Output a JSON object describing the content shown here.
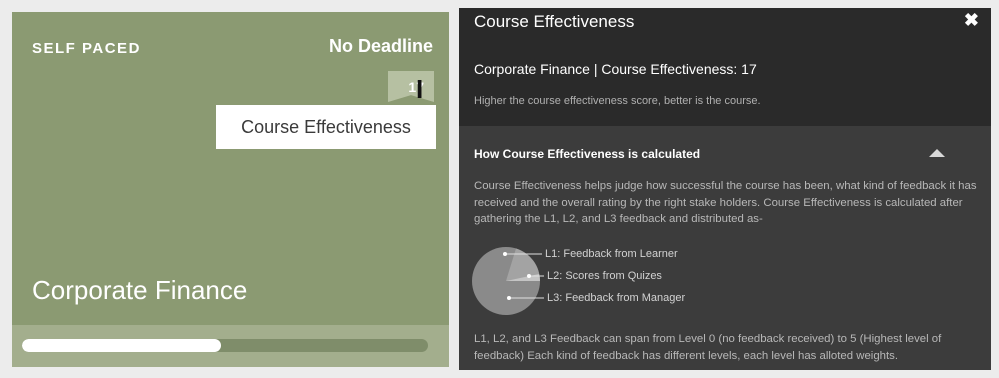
{
  "card": {
    "pacing": "SELF PACED",
    "deadline": "No Deadline",
    "score": "17",
    "tooltip": "Course Effectiveness",
    "course_title": "Corporate Finance",
    "progress_fraction": 0.49,
    "colors": {
      "background": "#8b9a72",
      "progress_band": "#a3ae8d",
      "progress_fill": "#ffffff"
    }
  },
  "modal": {
    "title": "Course Effectiveness",
    "close_icon": "close-icon",
    "subtitle": "Corporate Finance | Course Effectiveness: 17",
    "hint": "Higher the course effectiveness score, better is the course.",
    "section_heading": "How Course Effectiveness is calculated",
    "section_toggle_icon": "collapse-up-icon",
    "paragraph1": "Course Effectiveness helps judge how successful the course has been, what kind of feedback it has received and the overall rating by the right stake holders. Course Effectiveness is calculated after gathering the L1, L2, and L3 feedback and distributed as-",
    "legend": [
      {
        "label": "L1: Feedback from Learner"
      },
      {
        "label": "L2: Scores from Quizes"
      },
      {
        "label": "L3: Feedback from Manager"
      }
    ],
    "paragraph2": "L1, L2, and L3 Feedback can span from Level 0 (no feedback received) to 5 (Highest level of feedback) Each kind of feedback has different levels, each level has alloted weights.",
    "colors": {
      "header_bg": "#2a2a2a",
      "body_bg": "#3c3c3c"
    }
  }
}
